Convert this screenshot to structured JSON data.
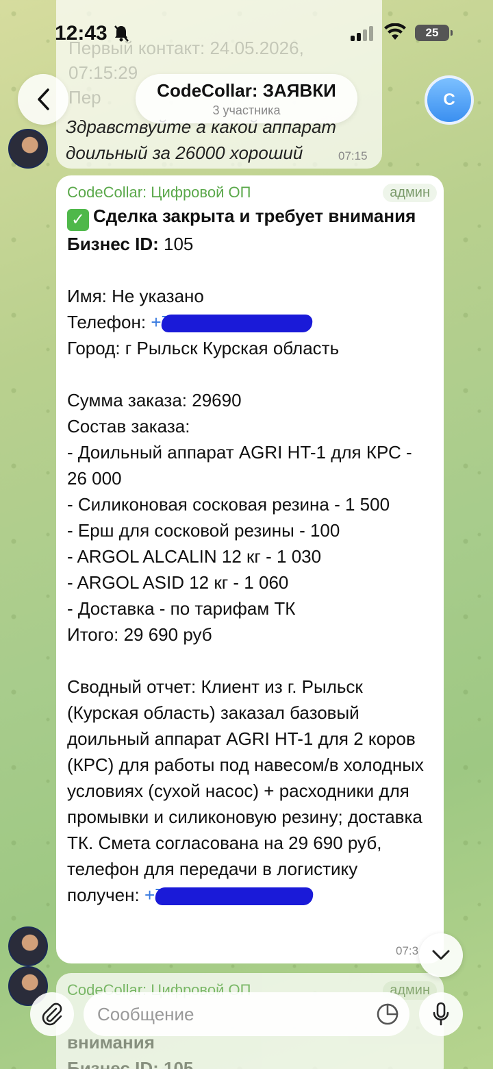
{
  "status_bar": {
    "time": "12:43",
    "battery": "25"
  },
  "header": {
    "title": "CodeCollar: ЗАЯВКИ",
    "subtitle": "3 участника",
    "avatar_letter": "C"
  },
  "previous_message": {
    "ghost_line1": "Первый контакт: 24.05.2026,",
    "ghost_line2": "07:15:29",
    "ghost_line3": "Пер",
    "line1": "Здравствуйте а какой аппарат",
    "line2": "доильный за 26000 хороший",
    "time": "07:15"
  },
  "message": {
    "sender": "CodeCollar: Цифровой ОП",
    "role": "админ",
    "heading": "Сделка закрыта и требует внимания",
    "business_id_label": "Бизнес ID:",
    "business_id": "105",
    "name_line": "Имя: Не указано",
    "phone_label": "Телефон:",
    "phone_prefix": "+7",
    "city_line": "Город: г Рыльск Курская область",
    "sum_line": "Сумма заказа: 29690",
    "items_title": "Состав заказа:",
    "items": [
      "- Доильный аппарат AGRI HT-1 для КРС - 26 000",
      "- Силиконовая сосковая резина - 1 500",
      "- Ерш для сосковой резины - 100",
      "- ARGOL ALCALIN 12 кг - 1 030",
      "- ARGOL ASID 12 кг - 1 060",
      "- Доставка - по тарифам ТК"
    ],
    "total_line": "Итого: 29 690 руб",
    "summary": "Сводный отчет: Клиент из г. Рыльск (Курская область) заказал базовый доильный аппарат AGRI HT-1 для 2 коров (КРС) для работы под навесом/в холодных условиях (сухой насос) + расходники для промывки и силиконовую резину; доставка ТК. Смета согласована на 29 690 руб, телефон для передачи в логистику",
    "received_label": "получен:",
    "time": "07:3"
  },
  "next_message": {
    "sender": "CodeCollar: Цифровой ОП",
    "role": "админ",
    "line1": "внимания",
    "line2": "Бизнес ID: 105"
  },
  "composer": {
    "placeholder": "Сообщение"
  }
}
